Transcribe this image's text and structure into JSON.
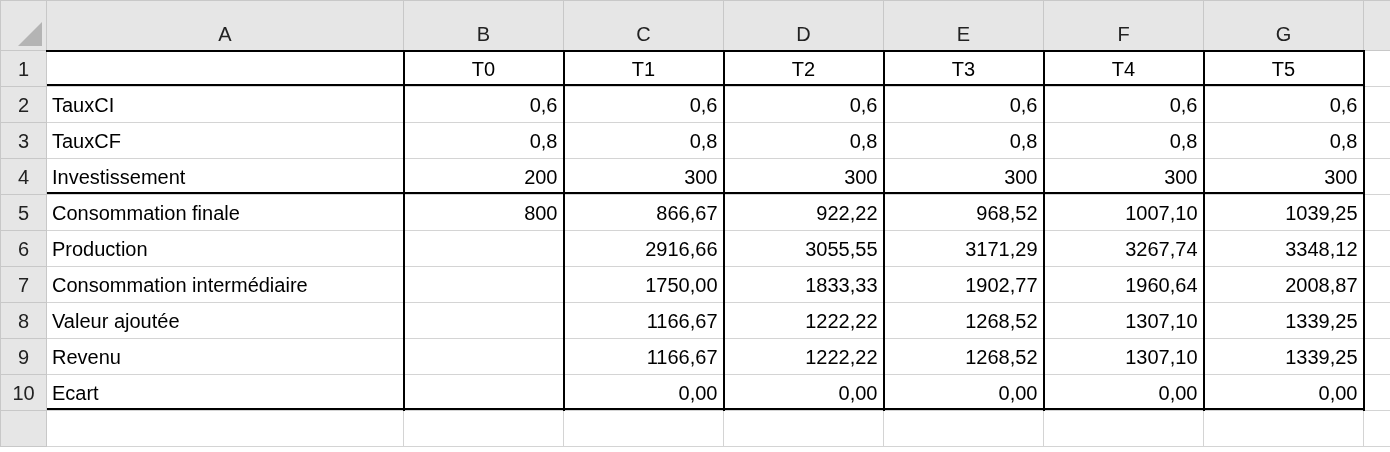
{
  "columns": [
    "A",
    "B",
    "C",
    "D",
    "E",
    "F",
    "G"
  ],
  "rows": [
    {
      "number": "1",
      "border_below": true,
      "cells": [
        "",
        "T0",
        "T1",
        "T2",
        "T3",
        "T4",
        "T5"
      ]
    },
    {
      "number": "2",
      "border_below": false,
      "cells": [
        "TauxCI",
        "0,6",
        "0,6",
        "0,6",
        "0,6",
        "0,6",
        "0,6"
      ]
    },
    {
      "number": "3",
      "border_below": false,
      "cells": [
        "TauxCF",
        "0,8",
        "0,8",
        "0,8",
        "0,8",
        "0,8",
        "0,8"
      ]
    },
    {
      "number": "4",
      "border_below": true,
      "cells": [
        "Investissement",
        "200",
        "300",
        "300",
        "300",
        "300",
        "300"
      ]
    },
    {
      "number": "5",
      "border_below": false,
      "cells": [
        "Consommation finale",
        "800",
        "866,67",
        "922,22",
        "968,52",
        "1007,10",
        "1039,25"
      ]
    },
    {
      "number": "6",
      "border_below": false,
      "cells": [
        "Production",
        "",
        "2916,66",
        "3055,55",
        "3171,29",
        "3267,74",
        "3348,12"
      ]
    },
    {
      "number": "7",
      "border_below": false,
      "cells": [
        "Consommation intermédiaire",
        "",
        "1750,00",
        "1833,33",
        "1902,77",
        "1960,64",
        "2008,87"
      ]
    },
    {
      "number": "8",
      "border_below": false,
      "cells": [
        "Valeur ajoutée",
        "",
        "1166,67",
        "1222,22",
        "1268,52",
        "1307,10",
        "1339,25"
      ]
    },
    {
      "number": "9",
      "border_below": false,
      "cells": [
        "Revenu",
        "",
        "1166,67",
        "1222,22",
        "1268,52",
        "1307,10",
        "1339,25"
      ]
    },
    {
      "number": "10",
      "border_below": true,
      "cells": [
        "Ecart",
        "",
        "0,00",
        "0,00",
        "0,00",
        "0,00",
        "0,00"
      ]
    }
  ]
}
